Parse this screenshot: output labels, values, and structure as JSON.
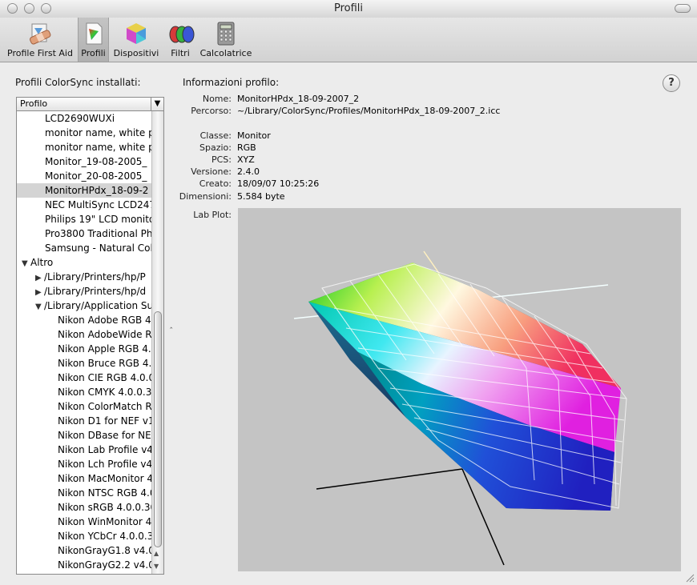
{
  "window": {
    "title": "Profili"
  },
  "toolbar": {
    "items": [
      {
        "label": "Profile First Aid",
        "icon": "first-aid-icon",
        "selected": false
      },
      {
        "label": "Profili",
        "icon": "profile-icon",
        "selected": true
      },
      {
        "label": "Dispositivi",
        "icon": "devices-icon",
        "selected": false
      },
      {
        "label": "Filtri",
        "icon": "filters-icon",
        "selected": false
      },
      {
        "label": "Calcolatrice",
        "icon": "calculator-icon",
        "selected": false
      }
    ]
  },
  "left": {
    "header": "Profili ColorSync installati:",
    "column_header": "Profilo",
    "rows": [
      {
        "text": "LCD2690WUXi",
        "indent": 1,
        "selected": false
      },
      {
        "text": "monitor name, white p",
        "indent": 1,
        "selected": false
      },
      {
        "text": "monitor name, white p",
        "indent": 1,
        "selected": false
      },
      {
        "text": "Monitor_19-08-2005_",
        "indent": 1,
        "selected": false
      },
      {
        "text": "Monitor_20-08-2005_",
        "indent": 1,
        "selected": false
      },
      {
        "text": "MonitorHPdx_18-09-2",
        "indent": 1,
        "selected": true
      },
      {
        "text": "NEC MultiSync LCD247",
        "indent": 1,
        "selected": false
      },
      {
        "text": "Philips 19\" LCD monito",
        "indent": 1,
        "selected": false
      },
      {
        "text": "Pro3800 Traditional Ph",
        "indent": 1,
        "selected": false
      },
      {
        "text": "Samsung - Natural Col",
        "indent": 1,
        "selected": false
      },
      {
        "text": "Altro",
        "indent": 0,
        "disclosure": "open"
      },
      {
        "text": "/Library/Printers/hp/P",
        "indent": 1,
        "disclosure": "closed"
      },
      {
        "text": "/Library/Printers/hp/d",
        "indent": 1,
        "disclosure": "closed"
      },
      {
        "text": "/Library/Application Su",
        "indent": 1,
        "disclosure": "open"
      },
      {
        "text": "Nikon Adobe RGB 4.",
        "indent": 2
      },
      {
        "text": "Nikon AdobeWide R",
        "indent": 2
      },
      {
        "text": "Nikon Apple RGB 4.0",
        "indent": 2
      },
      {
        "text": "Nikon Bruce RGB 4.0",
        "indent": 2
      },
      {
        "text": "Nikon CIE RGB 4.0.0",
        "indent": 2
      },
      {
        "text": "Nikon CMYK 4.0.0.3",
        "indent": 2
      },
      {
        "text": "Nikon ColorMatch R",
        "indent": 2
      },
      {
        "text": "Nikon D1 for NEF v1",
        "indent": 2
      },
      {
        "text": "Nikon DBase for NEF",
        "indent": 2
      },
      {
        "text": "Nikon Lab Profile v4",
        "indent": 2
      },
      {
        "text": "Nikon Lch Profile v4",
        "indent": 2
      },
      {
        "text": "Nikon MacMonitor 4",
        "indent": 2
      },
      {
        "text": "Nikon NTSC RGB 4.0",
        "indent": 2
      },
      {
        "text": "Nikon sRGB 4.0.0.30",
        "indent": 2
      },
      {
        "text": "Nikon WinMonitor 4",
        "indent": 2
      },
      {
        "text": "Nikon YCbCr 4.0.0.3",
        "indent": 2
      },
      {
        "text": "NikonGrayG1.8 v4.0",
        "indent": 2
      },
      {
        "text": "NikonGrayG2.2 v4.0",
        "indent": 2
      }
    ]
  },
  "info": {
    "header": "Informazioni profilo:",
    "fields": [
      {
        "label": "Nome:",
        "value": "MonitorHPdx_18-09-2007_2"
      },
      {
        "label": "Percorso:",
        "value": "~/Library/ColorSync/Profiles/MonitorHPdx_18-09-2007_2.icc"
      },
      {
        "label": "Classe:",
        "value": "Monitor"
      },
      {
        "label": "Spazio:",
        "value": "RGB"
      },
      {
        "label": "PCS:",
        "value": "XYZ"
      },
      {
        "label": "Versione:",
        "value": "2.4.0"
      },
      {
        "label": "Creato:",
        "value": "18/09/07 10:25:26"
      },
      {
        "label": "Dimensioni:",
        "value": "5.584 byte"
      }
    ],
    "lab_plot_label": "Lab Plot:",
    "help_label": "?"
  }
}
